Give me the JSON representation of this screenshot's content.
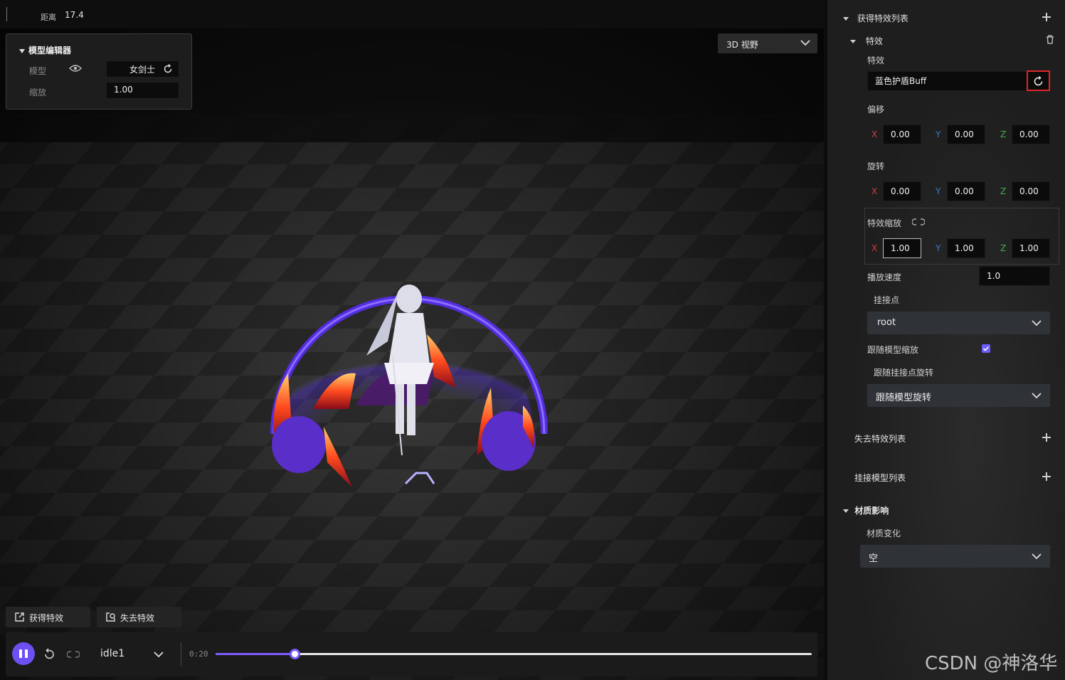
{
  "topbar": {
    "distance_label": "距离",
    "distance_value": "17.4"
  },
  "model_editor": {
    "title": "模型编辑器",
    "model_label": "模型",
    "model_value": "女剑士",
    "scale_label": "缩放",
    "scale_value": "1.00"
  },
  "view_select": {
    "value": "3D 视野"
  },
  "actions": {
    "gain_effect": "获得特效",
    "lose_effect": "失去特效"
  },
  "player": {
    "animation": "idle1",
    "time": "0:20",
    "progress": 0.133,
    "accent": "#6e4ff2"
  },
  "panel": {
    "gain_list_title": "获得特效列表",
    "effect_group": "特效",
    "effect_label": "特效",
    "effect_value": "蓝色护盾Buff",
    "offset_label": "偏移",
    "offset": {
      "x": "0.00",
      "y": "0.00",
      "z": "0.00"
    },
    "rotation_label": "旋转",
    "rotation": {
      "x": "0.00",
      "y": "0.00",
      "z": "0.00"
    },
    "effect_scale_label": "特效缩放",
    "effect_scale": {
      "x": "1.00",
      "y": "1.00",
      "z": "1.00"
    },
    "axis_x": "X",
    "axis_y": "Y",
    "axis_z": "Z",
    "speed_label": "播放速度",
    "speed_value": "1.0",
    "attach_label": "挂接点",
    "attach_value": "root",
    "follow_scale_label": "跟随模型缩放",
    "follow_scale_checked": true,
    "follow_rot_label": "跟随挂接点旋转",
    "follow_rot_value": "跟随模型旋转",
    "lose_list_title": "失去特效列表",
    "attach_model_title": "挂接模型列表",
    "material_title": "材质影响",
    "material_change_label": "材质变化",
    "material_change_value": "空"
  },
  "watermark": "CSDN @神洛华"
}
